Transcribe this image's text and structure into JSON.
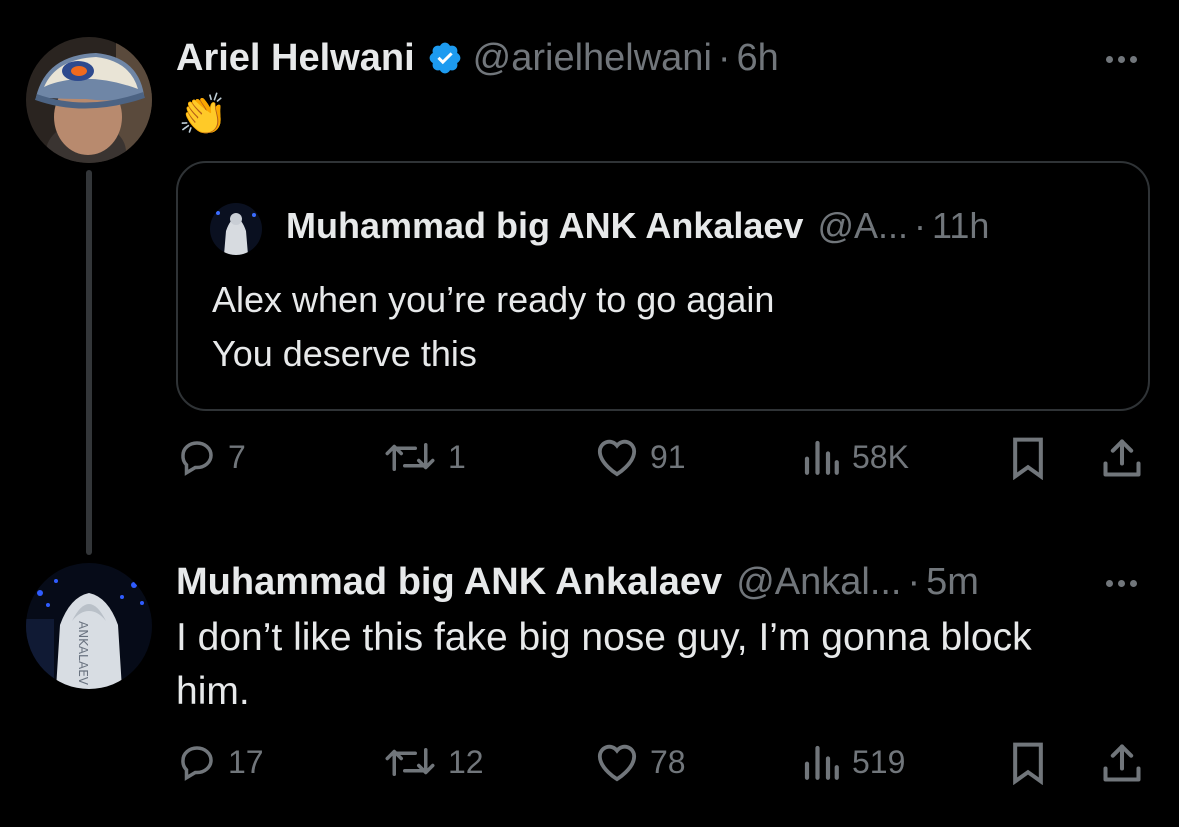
{
  "tweet1": {
    "name": "Ariel Helwani",
    "handle": "@arielhelwani",
    "sep": "·",
    "time": "6h",
    "body": "👏",
    "quote": {
      "name": "Muhammad big ANK Ankalaev",
      "handle": "@A...",
      "sep": "·",
      "time": "11h",
      "body": "Alex when you’re ready to go again\nYou deserve this"
    },
    "actions": {
      "replies": "7",
      "reposts": "1",
      "likes": "91",
      "views": "58K"
    }
  },
  "tweet2": {
    "name": "Muhammad big ANK Ankalaev",
    "handle": "@Ankal...",
    "sep": "·",
    "time": "5m",
    "body": "I don’t like this fake big nose guy, I’m gonna block\nhim.",
    "actions": {
      "replies": "17",
      "reposts": "12",
      "likes": "78",
      "views": "519"
    }
  },
  "colors": {
    "background": "#000000",
    "text": "#e7e9ea",
    "muted": "#71767b",
    "verified": "#1d9bf0",
    "border": "#2f3336"
  },
  "icons": [
    "reply-icon",
    "repost-icon",
    "like-icon",
    "views-icon",
    "bookmark-icon",
    "share-icon",
    "verified-badge-icon",
    "more-icon"
  ]
}
